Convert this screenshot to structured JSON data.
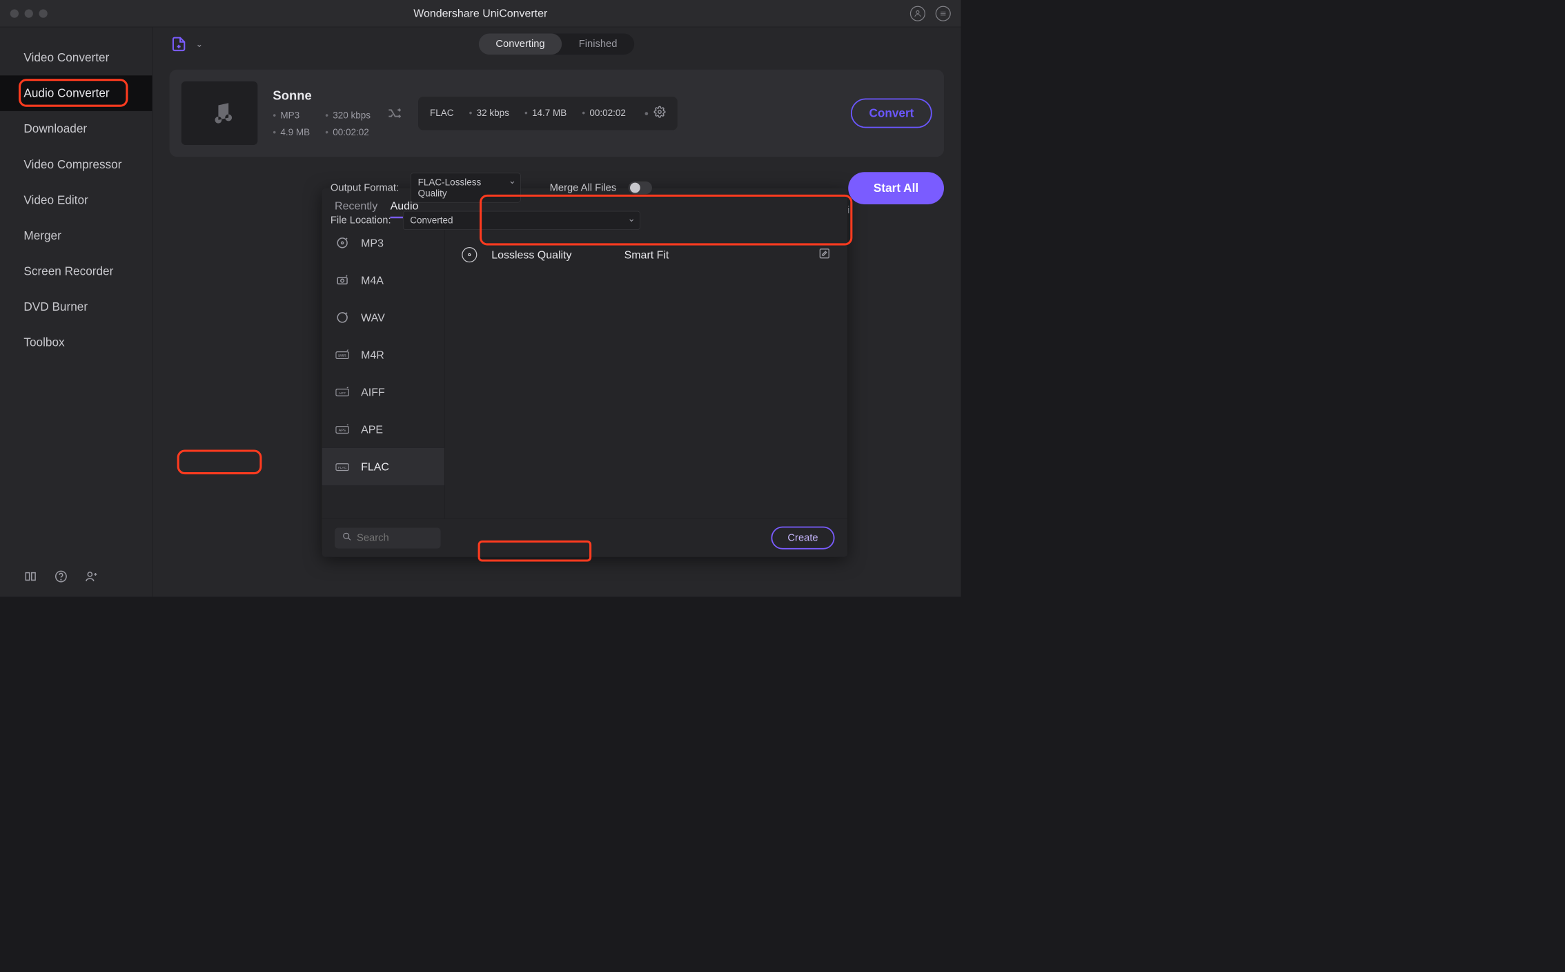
{
  "titlebar": {
    "title": "Wondershare UniConverter"
  },
  "sidebar": {
    "items": [
      {
        "label": "Video Converter"
      },
      {
        "label": "Audio Converter"
      },
      {
        "label": "Downloader"
      },
      {
        "label": "Video Compressor"
      },
      {
        "label": "Video Editor"
      },
      {
        "label": "Merger"
      },
      {
        "label": "Screen Recorder"
      },
      {
        "label": "DVD Burner"
      },
      {
        "label": "Toolbox"
      }
    ],
    "active_index": 1
  },
  "tabs": {
    "converting": "Converting",
    "finished": "Finished",
    "active": "converting"
  },
  "file": {
    "title": "Sonne",
    "source": {
      "format": "MP3",
      "bitrate": "320 kbps",
      "size": "4.9 MB",
      "duration": "00:02:02"
    },
    "target": {
      "format": "FLAC",
      "bitrate": "32 kbps",
      "size": "14.7 MB",
      "duration": "00:02:02"
    },
    "convert_label": "Convert"
  },
  "popover": {
    "tabs": {
      "recently": "Recently",
      "audio": "Audio",
      "active": "audio"
    },
    "formats": [
      {
        "label": "MP3"
      },
      {
        "label": "M4A"
      },
      {
        "label": "WAV"
      },
      {
        "label": "M4R"
      },
      {
        "label": "AIFF"
      },
      {
        "label": "APE"
      },
      {
        "label": "FLAC"
      }
    ],
    "selected_format_index": 6,
    "preset": {
      "quality": "Lossless Quality",
      "fit": "Smart Fit"
    },
    "search_placeholder": "Search",
    "create_label": "Create"
  },
  "bottom": {
    "output_format_label": "Output Format:",
    "output_format_value": "FLAC-Lossless Quality",
    "merge_label": "Merge All Files",
    "file_location_label": "File Location:",
    "file_location_value": "Converted",
    "start_all_label": "Start All"
  }
}
